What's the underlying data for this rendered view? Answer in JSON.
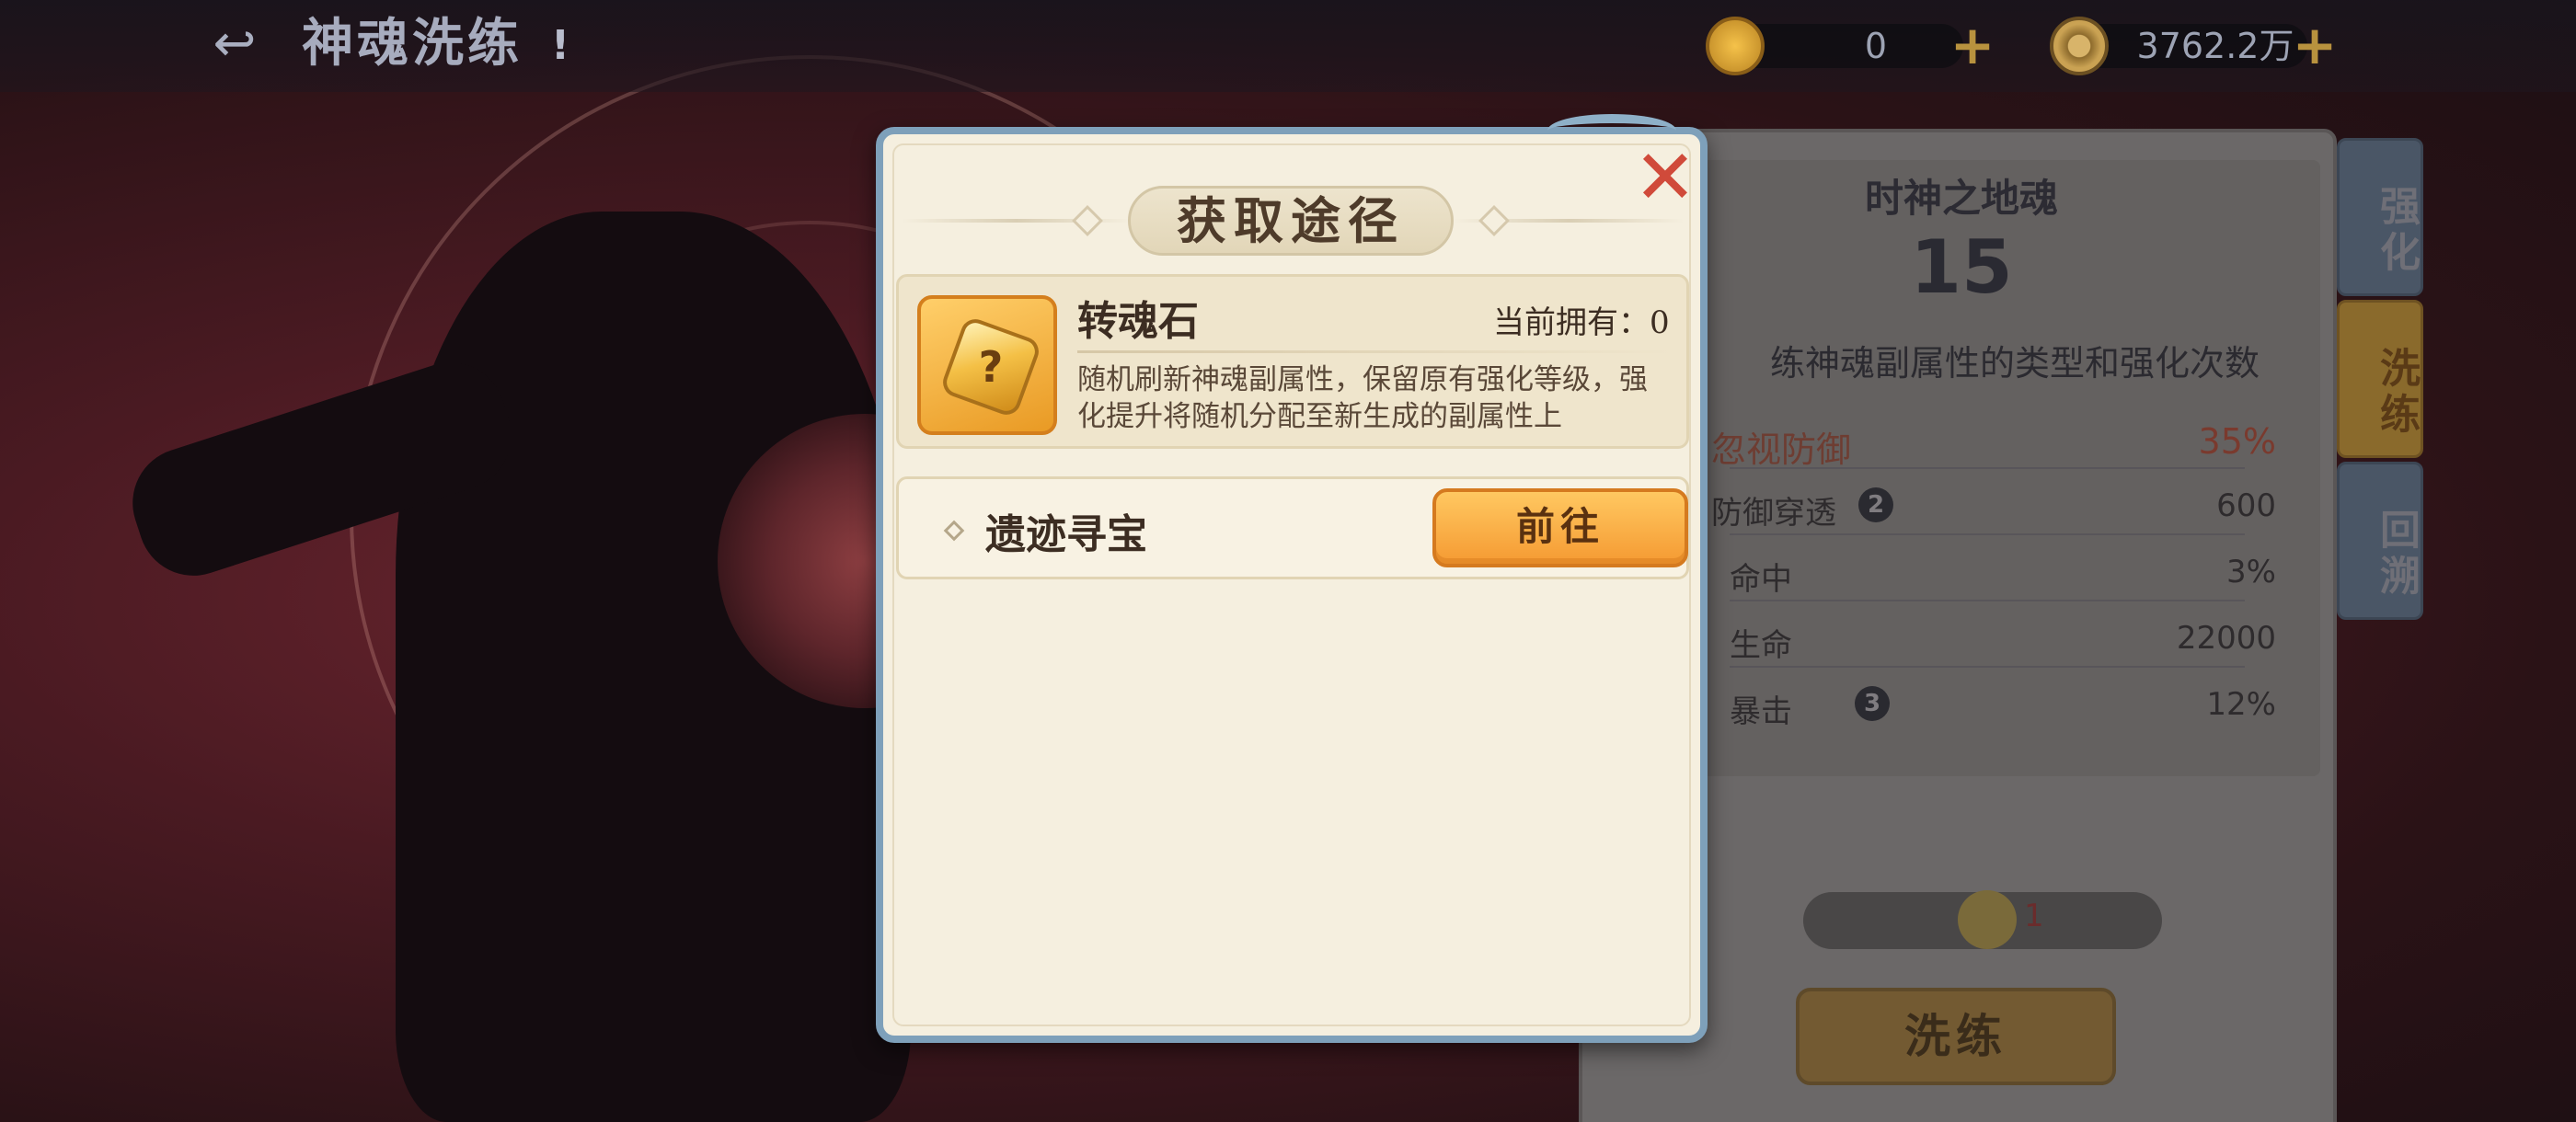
{
  "header": {
    "title": "神魂洗练",
    "info_icon": "!",
    "back_icon": "back-arrow-icon",
    "currencies": [
      {
        "icon": "soul-stone-icon",
        "amount": "0",
        "plus": "+"
      },
      {
        "icon": "copper-coin-icon",
        "amount": "3762.2万",
        "plus": "+"
      }
    ]
  },
  "soul_panel": {
    "name": "时神之地魂",
    "level": "15",
    "description": "练神魂副属性的类型和强化次数",
    "stats": [
      {
        "name": "忽视防御",
        "value": "35%",
        "badge": ""
      },
      {
        "name": "防御穿透",
        "value": "600",
        "badge": "2"
      },
      {
        "name": "命中",
        "value": "3%",
        "badge": ""
      },
      {
        "name": "生命",
        "value": "22000",
        "badge": ""
      },
      {
        "name": "暴击",
        "value": "12%",
        "badge": "3"
      }
    ],
    "cost": "1",
    "refine_label": "洗练"
  },
  "side_tabs": [
    {
      "label": "强化",
      "active": false
    },
    {
      "label": "洗练",
      "active": true
    },
    {
      "label": "回溯",
      "active": false
    }
  ],
  "modal": {
    "title": "获取途径",
    "close_icon": "✕",
    "item": {
      "name": "转魂石",
      "owned_label": "当前拥有：0",
      "icon_mark": "?",
      "description": "随机刷新神魂副属性，保留原有强化等级，强化提升将随机分配至新生成的副属性上"
    },
    "sources": [
      {
        "name": "遗迹寻宝",
        "button": "前往"
      }
    ]
  }
}
